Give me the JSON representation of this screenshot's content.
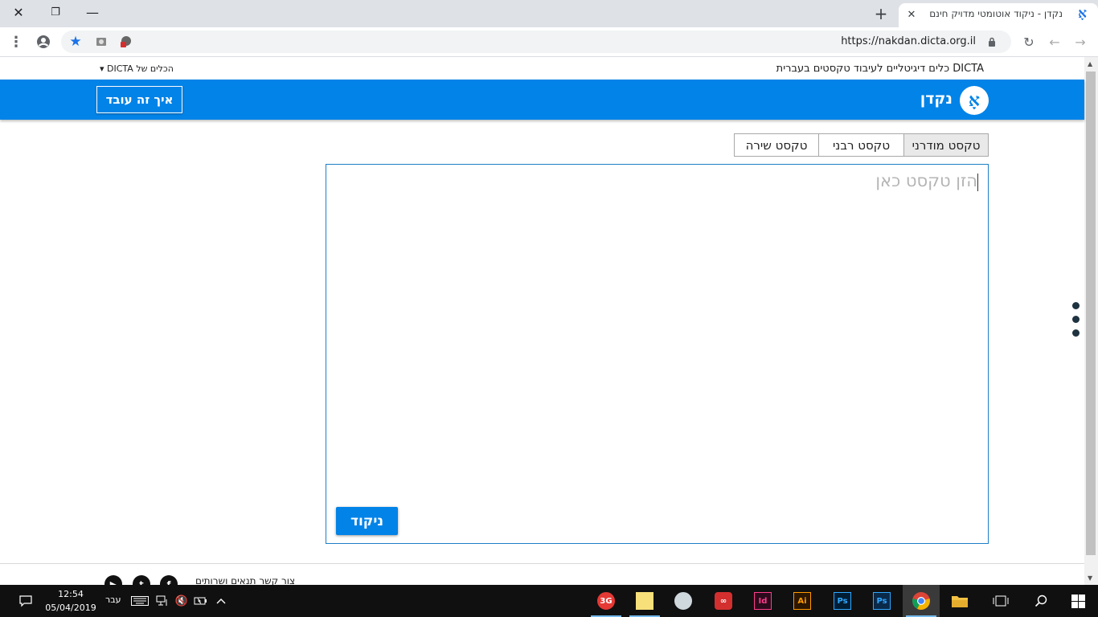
{
  "browser": {
    "tab_title": "נקדן - ניקוד אוטומטי מדויק חינם",
    "tab_favicon_glyph": "אָ",
    "url": "https://nakdan.dicta.org.il",
    "new_tab_glyph": "+",
    "close_glyph": "✕"
  },
  "site": {
    "tagline": "DICTA כלים דיגיטליים לעיבוד טקסטים בעברית",
    "tools_menu": "הכלים של DICTA ▾",
    "logo_glyph": "אָ",
    "name": "נקדן",
    "how_button": "איך זה עובד",
    "accent_color": "#0183e8"
  },
  "text_tabs": [
    {
      "label": "טקסט מודרני",
      "active": true
    },
    {
      "label": "טקסט רבני",
      "active": false
    },
    {
      "label": "טקסט שירה",
      "active": false
    }
  ],
  "editor": {
    "placeholder": "הזן טקסט כאן",
    "submit_button": "ניקוד"
  },
  "footer": {
    "links": "צור קשר תנאים ושרותים",
    "social": [
      "f",
      "t",
      "▶"
    ]
  },
  "taskbar": {
    "time": "12:54",
    "date": "05/04/2019",
    "language": "עבר",
    "apps": [
      "3G",
      "Notes",
      "Cloud",
      "Cc",
      "Id",
      "Ai",
      "Ps",
      "Ps",
      "Chrome",
      "Files"
    ]
  }
}
